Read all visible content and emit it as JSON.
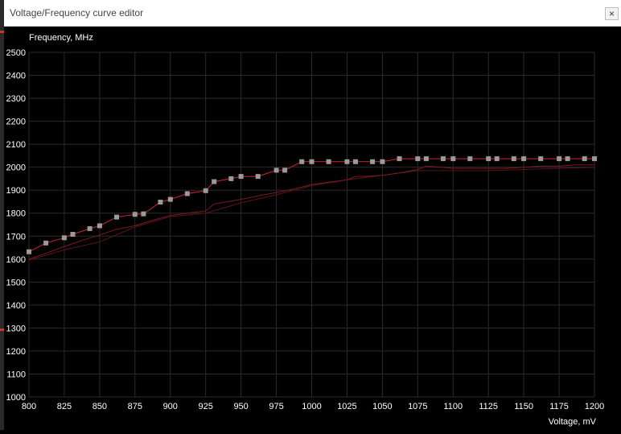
{
  "window": {
    "title": "Voltage/Frequency curve editor",
    "close_label": "×"
  },
  "colors": {
    "background": "#000000",
    "grid": "#2b2b2b",
    "curve": "#d0252f",
    "point": "#9a9a9a",
    "text": "#ffffff"
  },
  "chart_data": {
    "type": "line",
    "xlabel": "Voltage, mV",
    "ylabel": "Frequency, MHz",
    "xlim": [
      800,
      1200
    ],
    "ylim": [
      1000,
      2500
    ],
    "x_ticks": [
      800,
      825,
      850,
      875,
      900,
      925,
      950,
      975,
      1000,
      1025,
      1050,
      1075,
      1100,
      1125,
      1150,
      1175,
      1200
    ],
    "y_ticks": [
      1000,
      1100,
      1200,
      1300,
      1400,
      1500,
      1600,
      1700,
      1800,
      1900,
      2000,
      2100,
      2200,
      2300,
      2400,
      2500
    ],
    "grid": true,
    "series": [
      {
        "role": "editable-curve",
        "x": [
          800,
          812,
          825,
          831,
          843,
          850,
          862,
          875,
          881,
          893,
          900,
          912,
          925,
          931,
          943,
          950,
          962,
          975,
          981,
          993,
          1000,
          1012,
          1025,
          1031,
          1043,
          1050,
          1062,
          1075,
          1081,
          1093,
          1100,
          1112,
          1125,
          1131,
          1143,
          1150,
          1162,
          1175,
          1181,
          1193,
          1200
        ],
        "y": [
          1632,
          1670,
          1693,
          1708,
          1733,
          1745,
          1783,
          1795,
          1797,
          1848,
          1860,
          1885,
          1898,
          1937,
          1950,
          1960,
          1960,
          1987,
          1987,
          2024,
          2024,
          2024,
          2024,
          2024,
          2024,
          2024,
          2037,
          2037,
          2037,
          2037,
          2037,
          2037,
          2037,
          2037,
          2037,
          2037,
          2037,
          2037,
          2037,
          2037,
          2037
        ]
      },
      {
        "role": "default-curve",
        "x": [
          800,
          812,
          825,
          837,
          850,
          862,
          875,
          887,
          900,
          912,
          925,
          931,
          950,
          962,
          975,
          987,
          1000,
          1012,
          1025,
          1031,
          1037,
          1050,
          1062,
          1075,
          1081,
          1093,
          1100,
          1112,
          1125,
          1137,
          1150,
          1162,
          1175,
          1187,
          1200
        ],
        "y": [
          1600,
          1625,
          1655,
          1680,
          1705,
          1730,
          1745,
          1768,
          1790,
          1800,
          1810,
          1840,
          1860,
          1875,
          1890,
          1905,
          1925,
          1935,
          1945,
          1960,
          1960,
          1965,
          1975,
          1990,
          2005,
          2000,
          1995,
          1995,
          1995,
          1995,
          2000,
          2005,
          2005,
          2010,
          2010
        ]
      },
      {
        "role": "baseline-curve",
        "x": [
          800,
          825,
          850,
          875,
          900,
          925,
          950,
          975,
          1000,
          1025,
          1050,
          1075,
          1100,
          1125,
          1150,
          1175,
          1200
        ],
        "y": [
          1596,
          1640,
          1675,
          1740,
          1785,
          1800,
          1845,
          1880,
          1920,
          1945,
          1965,
          1985,
          1985,
          1985,
          1990,
          1995,
          2000
        ]
      }
    ]
  }
}
